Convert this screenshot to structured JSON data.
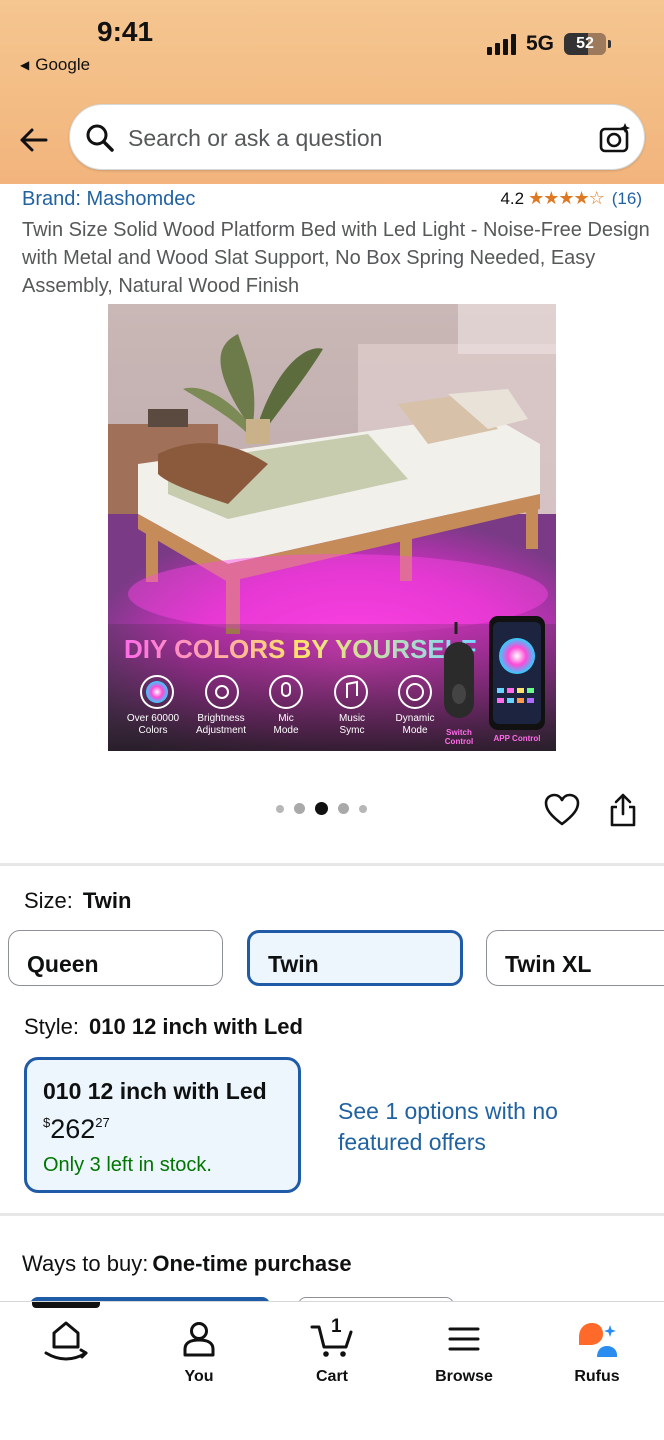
{
  "status_bar": {
    "time": "9:41",
    "back_app": "Google",
    "network": "5G",
    "battery": "52"
  },
  "search": {
    "placeholder": "Search or ask a question"
  },
  "product": {
    "brand": "Brand: Mashomdec",
    "rating": "4.2",
    "stars": "★★★★☆",
    "review_count": "(16)",
    "title": "Twin Size Solid Wood Platform Bed with Led Light - Noise-Free Design with Metal and Wood Slat Support, No Box Spring Needed, Easy Assembly, Natural Wood Finish"
  },
  "image": {
    "headline": "DIY COLORS BY YOURSELF",
    "features": [
      {
        "label1": "Over 60000",
        "label2": "Colors"
      },
      {
        "label1": "Brightness",
        "label2": "Adjustment"
      },
      {
        "label1": "Mic",
        "label2": "Mode"
      },
      {
        "label1": "Music",
        "label2": "Symc"
      },
      {
        "label1": "Dynamic",
        "label2": "Mode"
      }
    ],
    "switch_label1": "Switch",
    "switch_label2": "Control",
    "app_label": "APP Control"
  },
  "carousel": {
    "count": 5,
    "active_index": 2
  },
  "size": {
    "label": "Size:",
    "selected": "Twin",
    "options": [
      "Queen",
      "Twin",
      "Twin XL"
    ]
  },
  "style": {
    "label": "Style:",
    "selected": "010 12 inch with Led",
    "card": {
      "name": "010 12 inch with Led",
      "currency": "$",
      "price_whole": "262",
      "price_fraction": "27",
      "stock": "Only 3 left in stock."
    },
    "see_options": "See 1 options with no featured offers"
  },
  "ways_to_buy": {
    "label": "Ways to buy:",
    "value": "One-time purchase"
  },
  "bottom_nav": {
    "items": [
      {
        "label": "",
        "icon": "home-icon"
      },
      {
        "label": "You",
        "icon": "person-icon"
      },
      {
        "label": "Cart",
        "icon": "cart-icon",
        "badge": "1"
      },
      {
        "label": "Browse",
        "icon": "menu-icon"
      },
      {
        "label": "Rufus",
        "icon": "rufus-icon"
      }
    ]
  },
  "colors": {
    "header_orange": "#f2b47c",
    "link_blue": "#2162a1",
    "selected_border": "#1f5ba6",
    "stock_green": "#007600",
    "star_orange": "#de7921",
    "rufus_orange": "#ff6a2a"
  }
}
